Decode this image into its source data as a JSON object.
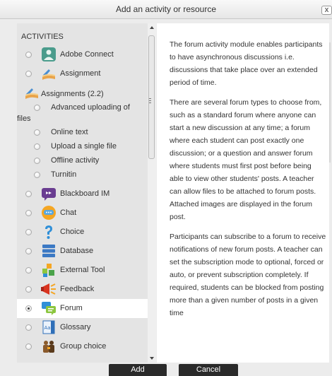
{
  "dialog": {
    "title": "Add an activity or resource",
    "close_label": "x"
  },
  "chooser": {
    "heading": "Activities",
    "items": [
      {
        "label": "Adobe Connect",
        "icon": "adobe-connect-icon",
        "selected": false
      },
      {
        "label": "Assignment",
        "icon": "assignment-icon",
        "selected": false
      },
      {
        "label": "Assignments (2.2)",
        "icon": "assignment-icon",
        "selected": false
      },
      {
        "label": "Advanced uploading of",
        "label2": "files",
        "selected": false
      },
      {
        "label": "Online text",
        "selected": false
      },
      {
        "label": "Upload a single file",
        "selected": false
      },
      {
        "label": "Offline activity",
        "selected": false
      },
      {
        "label": "Turnitin",
        "selected": false
      },
      {
        "label": "Blackboard IM",
        "icon": "blackboard-im-icon",
        "selected": false
      },
      {
        "label": "Chat",
        "icon": "chat-icon",
        "selected": false
      },
      {
        "label": "Choice",
        "icon": "choice-icon",
        "selected": false
      },
      {
        "label": "Database",
        "icon": "database-icon",
        "selected": false
      },
      {
        "label": "External Tool",
        "icon": "external-tool-icon",
        "selected": false
      },
      {
        "label": "Feedback",
        "icon": "feedback-icon",
        "selected": false
      },
      {
        "label": "Forum",
        "icon": "forum-icon",
        "selected": true
      },
      {
        "label": "Glossary",
        "icon": "glossary-icon",
        "selected": false
      },
      {
        "label": "Group choice",
        "icon": "group-choice-icon",
        "selected": false
      }
    ]
  },
  "description": {
    "paragraphs": [
      "The forum activity module enables participants to have asynchronous discussions i.e. discussions that take place over an extended period of time.",
      "There are several forum types to choose from, such as a standard forum where anyone can start a new discussion at any time; a forum where each student can post exactly one discussion; or a question and answer forum where students must first post before being able to view other students' posts. A teacher can allow files to be attached to forum posts. Attached images are displayed in the forum post.",
      "Participants can subscribe to a forum to receive notifications of new forum posts. A teacher can set the subscription mode to optional, forced or auto, or prevent subscription completely. If required, students can be blocked from posting more than a given number of posts in a given time"
    ]
  },
  "footer": {
    "add_label": "Add",
    "cancel_label": "Cancel"
  },
  "colors": {
    "selected_row": "#ffffff",
    "list_background": "#e4e4e4",
    "button_background": "#2a2a2a"
  }
}
